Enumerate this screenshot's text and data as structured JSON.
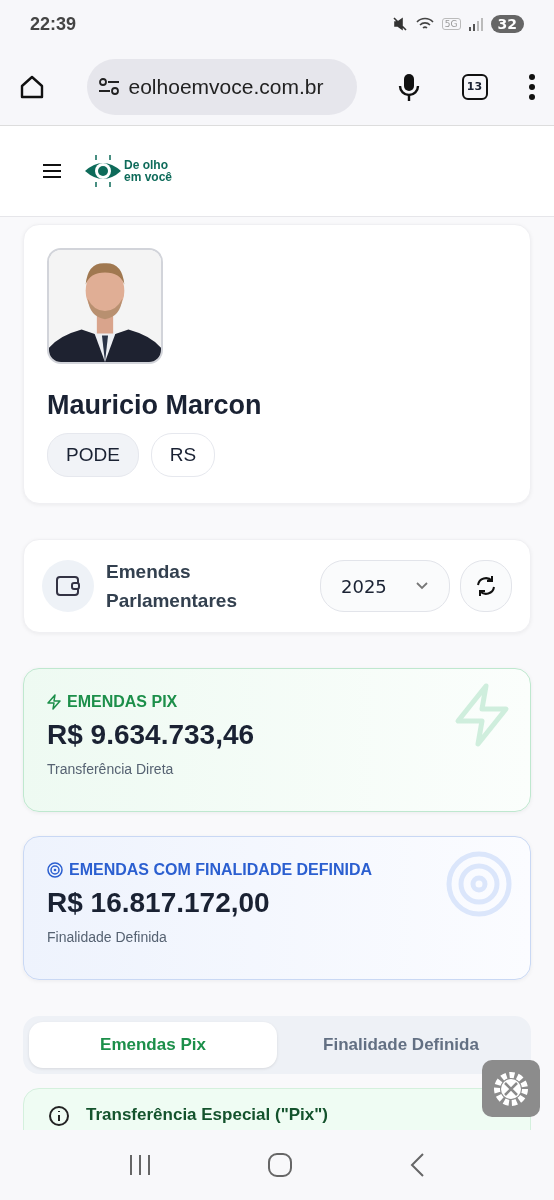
{
  "status_bar": {
    "time": "22:39",
    "battery": "32",
    "network": "5G"
  },
  "browser": {
    "url": "eolhoemvoce.com.br",
    "tab_count": "13"
  },
  "site": {
    "logo_text": [
      "De olho",
      "em você"
    ]
  },
  "profile": {
    "name": "Mauricio Marcon",
    "tags": [
      "PODE",
      "RS"
    ]
  },
  "section": {
    "title": "Emendas Parlamentares",
    "year": "2025"
  },
  "summaries": [
    {
      "kind": "pix",
      "label": "EMENDAS PIX",
      "amount": "R$ 9.634.733,46",
      "caption": "Transferência Direta"
    },
    {
      "kind": "target",
      "label": "EMENDAS COM FINALIDADE DEFINIDA",
      "amount": "R$ 16.817.172,00",
      "caption": "Finalidade Definida"
    }
  ],
  "tabs": [
    {
      "label": "Emendas Pix",
      "selected": true
    },
    {
      "label": "Finalidade Definida",
      "selected": false
    }
  ],
  "info_card": {
    "title": "Transferência Especial (\"Pix\")"
  }
}
